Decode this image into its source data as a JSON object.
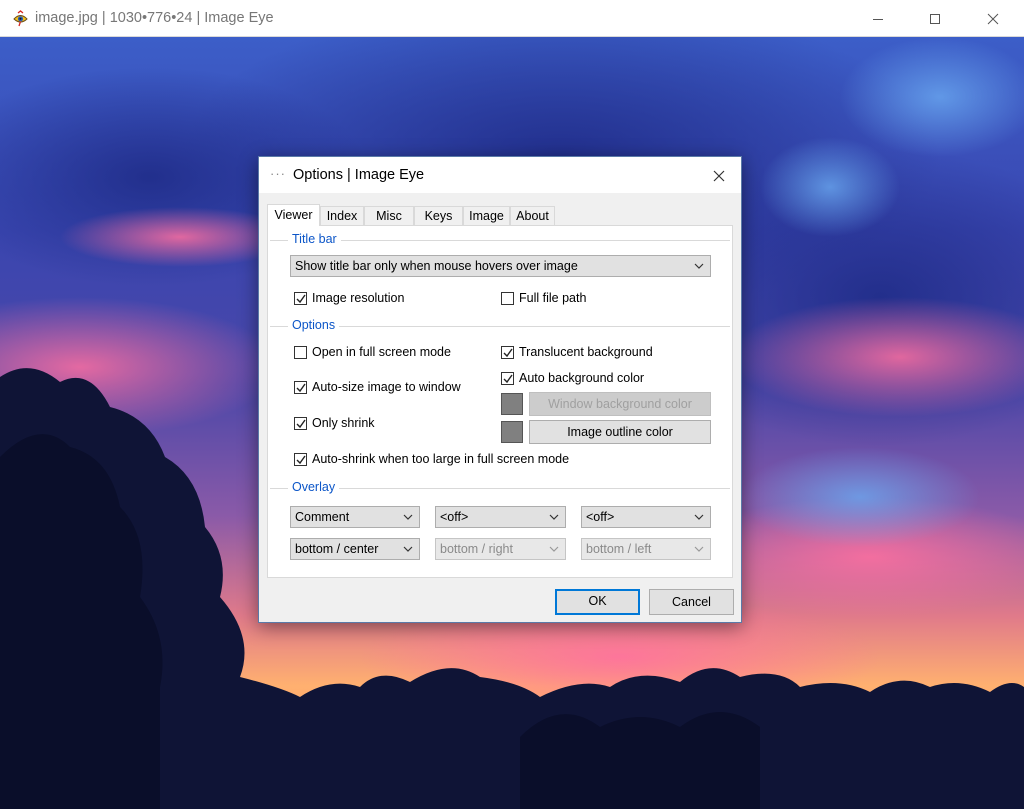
{
  "window": {
    "title": "image.jpg | 1030•776•24 | Image Eye",
    "app_icon": "image-eye-icon"
  },
  "dialog": {
    "title": "Options | Image Eye",
    "tabs": [
      {
        "label": "Viewer",
        "active": true
      },
      {
        "label": "Index"
      },
      {
        "label": "Misc"
      },
      {
        "label": "Keys"
      },
      {
        "label": "Image"
      },
      {
        "label": "About"
      }
    ],
    "titlebar_group": {
      "title": "Title bar",
      "mode_select": "Show title bar only when mouse hovers over image",
      "image_resolution": {
        "label": "Image resolution",
        "checked": true
      },
      "full_file_path": {
        "label": "Full file path",
        "checked": false
      }
    },
    "options_group": {
      "title": "Options",
      "open_full_screen": {
        "label": "Open in full screen mode",
        "checked": false
      },
      "auto_size": {
        "label": "Auto-size image to window",
        "checked": true
      },
      "only_shrink": {
        "label": "Only shrink",
        "checked": true
      },
      "auto_shrink_full_screen": {
        "label": "Auto-shrink when too large in full screen mode",
        "checked": true
      },
      "translucent_background": {
        "label": "Translucent background",
        "checked": true
      },
      "auto_background_color": {
        "label": "Auto background color",
        "checked": true
      },
      "window_background_color_button": "Window background color",
      "image_outline_color_button": "Image outline color",
      "swatch_color": "#808080"
    },
    "overlay_group": {
      "title": "Overlay",
      "row1": [
        "Comment",
        "<off>",
        "<off>"
      ],
      "row2": [
        "bottom / center",
        "bottom / right",
        "bottom / left"
      ]
    },
    "ok_label": "OK",
    "cancel_label": "Cancel"
  },
  "colors": {
    "group_title": "#0c56c8",
    "default_button_border": "#0078d7"
  }
}
